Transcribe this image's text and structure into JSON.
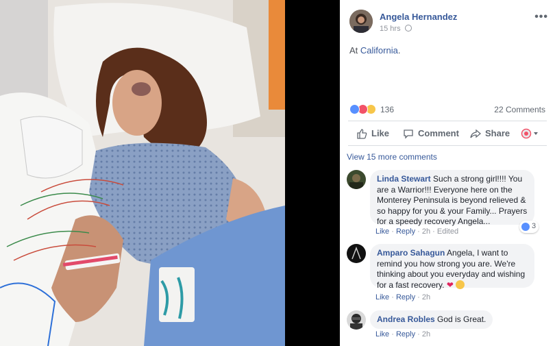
{
  "post": {
    "author": "Angela Hernandez",
    "time": "15 hrs",
    "location_prefix": "At ",
    "location": "California",
    "location_suffix": ".",
    "reaction_count": "136",
    "comment_count": "22 Comments"
  },
  "actions": {
    "like": "Like",
    "comment": "Comment",
    "share": "Share"
  },
  "view_more": "View 15 more comments",
  "comments": [
    {
      "name": "Linda Stewart",
      "text": "Such a strong girl!!!! You are a Warrior!!! Everyone here on the Monterey Peninsula is beyond relieved & so happy for you & your Family... Prayers for a speedy recovery Angela...",
      "like": "Like",
      "reply": "Reply",
      "time": "2h",
      "edited": "Edited",
      "reactions": "3"
    },
    {
      "name": "Amparo Sahagun",
      "text": "Angela, I want to remind you how strong you are. We're thinking about you everyday and wishing for a fast recovery.",
      "like": "Like",
      "reply": "Reply",
      "time": "2h"
    },
    {
      "name": "Andrea Robles",
      "text": "God is Great.",
      "like": "Like",
      "reply": "Reply",
      "time": "2h"
    }
  ],
  "colors": {
    "link": "#365899",
    "like": "#5890ff",
    "love": "#f25268",
    "sad": "#f7c64a"
  }
}
